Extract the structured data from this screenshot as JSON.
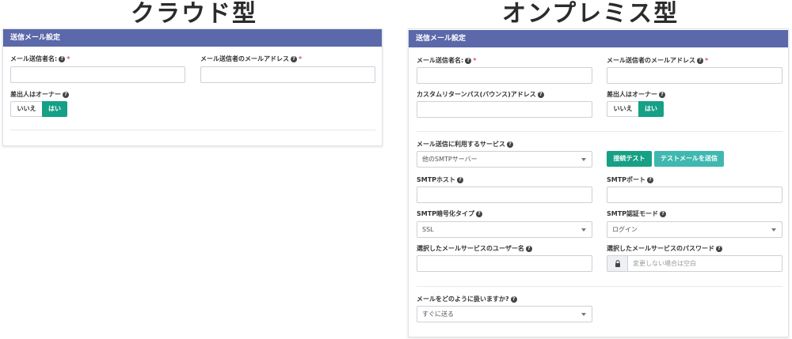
{
  "titles": {
    "cloud": "クラウド型",
    "onprem": "オンプレミス型"
  },
  "cloud": {
    "header": "送信メール設定",
    "sender_name_label": "メール送信者名:",
    "sender_name_value": "",
    "sender_email_label": "メール送信者のメールアドレス",
    "sender_email_value": "",
    "owner_label": "差出人はオーナー",
    "toggle_no": "いいえ",
    "toggle_yes": "はい"
  },
  "onprem": {
    "header": "送信メール設定",
    "sender_name_label": "メール送信者名:",
    "sender_name_value": "",
    "sender_email_label": "メール送信者のメールアドレス",
    "sender_email_value": "",
    "return_path_label": "カスタムリターンパス(バウンス)アドレス",
    "return_path_value": "",
    "owner_label": "差出人はオーナー",
    "toggle_no": "いいえ",
    "toggle_yes": "はい",
    "service_label": "メール送信に利用するサービス",
    "service_value": "他のSMTPサーバー",
    "test_button": "接続テスト",
    "send_test_button": "テストメールを送信",
    "smtp_host_label": "SMTPホスト",
    "smtp_host_value": "",
    "smtp_port_label": "SMTPポート",
    "smtp_port_value": "",
    "encryption_label": "SMTP暗号化タイプ",
    "encryption_value": "SSL",
    "auth_mode_label": "SMTP認証モード",
    "auth_mode_value": "ログイン",
    "username_label": "選択したメールサービスのユーザー名",
    "username_value": "",
    "password_label": "選択したメールサービスのパスワード",
    "password_placeholder": "変更しない場合は空白",
    "handling_label": "メールをどのように扱いますか?",
    "handling_value": "すぐに送る"
  },
  "icons": {
    "help": "question-circle-icon",
    "lock": "lock-icon",
    "caret": "chevron-down-icon"
  },
  "colors": {
    "header_bg": "#5b68a9",
    "toggle_active": "#16a085",
    "button_secondary": "#3fb8b0",
    "required": "#d9534f"
  }
}
